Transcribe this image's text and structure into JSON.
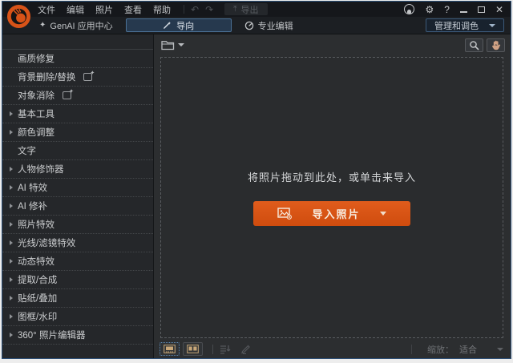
{
  "titlebar": {
    "menu": [
      "文件",
      "编辑",
      "照片",
      "查看",
      "帮助"
    ],
    "export_label": "导出"
  },
  "modebar": {
    "genai_label": "GenAI 应用中心",
    "guided_label": "导向",
    "pro_edit_label": "专业编辑",
    "manage_label": "管理和调色"
  },
  "sidebar": {
    "items": [
      {
        "label": "画质修复",
        "arrow": false,
        "badge": false
      },
      {
        "label": "背景删除/替换",
        "arrow": false,
        "badge": true
      },
      {
        "label": "对象消除",
        "arrow": false,
        "badge": true
      },
      {
        "label": "基本工具",
        "arrow": true,
        "badge": false
      },
      {
        "label": "颜色调整",
        "arrow": true,
        "badge": false
      },
      {
        "label": "文字",
        "arrow": false,
        "badge": false
      },
      {
        "label": "人物修饰器",
        "arrow": true,
        "badge": false
      },
      {
        "label": "AI 特效",
        "arrow": true,
        "badge": false
      },
      {
        "label": "AI 修补",
        "arrow": true,
        "badge": false
      },
      {
        "label": "照片特效",
        "arrow": true,
        "badge": false
      },
      {
        "label": "光线/滤镜特效",
        "arrow": true,
        "badge": false
      },
      {
        "label": "动态特效",
        "arrow": true,
        "badge": false
      },
      {
        "label": "提取/合成",
        "arrow": true,
        "badge": false
      },
      {
        "label": "贴纸/叠加",
        "arrow": true,
        "badge": false
      },
      {
        "label": "图框/水印",
        "arrow": true,
        "badge": false
      },
      {
        "label": "360° 照片编辑器",
        "arrow": true,
        "badge": false
      }
    ]
  },
  "main": {
    "dropzone_text": "将照片拖动到此处，或单击来导入",
    "import_label": "导入照片"
  },
  "statusbar": {
    "zoom_label": "缩放：",
    "zoom_value": "适合"
  },
  "icons": {
    "undo": "↶",
    "redo": "↷",
    "export": "⤒",
    "settings": "⚙",
    "help": "?",
    "close": "✕",
    "genai_sparkle": "✦",
    "ai_badge_star": "✦"
  },
  "colors": {
    "accent_orange": "#d85212",
    "selected_blue_border": "#4b7095",
    "window_border": "#2d5078",
    "titlebar_bg": "#15171b",
    "sidebar_bg": "#25272a",
    "main_bg": "#2c2e30"
  }
}
